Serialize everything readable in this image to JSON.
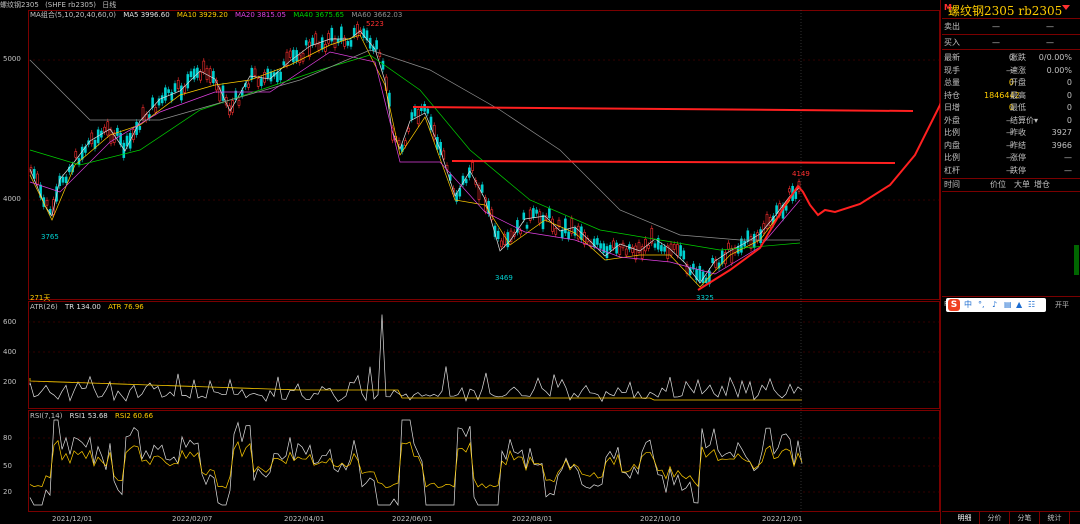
{
  "header": {
    "name": "螺纹钢2305",
    "exchange_code": "(SHFE rb2305)",
    "period": "日线"
  },
  "legend_ma": {
    "name": "MA组合(5,10,20,40,60,0)",
    "ma5": "MA5 3996.60",
    "ma10": "MA10 3929.20",
    "ma20": "MA20 3815.05",
    "ma40": "MA40 3675.65",
    "ma60": "MA60 3662.03"
  },
  "legend_atr": {
    "name": "ATR(26)",
    "tr": "TR 134.00",
    "atr": "ATR 76.96"
  },
  "legend_rsi": {
    "name": "RSI(7,14)",
    "rsi1": "RSI1 53.68",
    "rsi2": "RSI2 60.66"
  },
  "price_axis": [
    "5000",
    "4000"
  ],
  "atr_axis": [
    "600",
    "400",
    "200"
  ],
  "rsi_axis": [
    "80",
    "50",
    "20"
  ],
  "date_axis": [
    "2021/12/01",
    "2022/02/07",
    "2022/04/01",
    "2022/06/01",
    "2022/08/01",
    "2022/10/10",
    "2022/12/01"
  ],
  "annotations": {
    "high": "5223",
    "low1": "3765",
    "low2": "3469",
    "low3": "3325",
    "recent_high": "4149",
    "days": "271天"
  },
  "sidebar": {
    "title": "螺纹钢2305 rb2305",
    "marker": "M",
    "sell_label": "卖出",
    "sell_val": "—",
    "sell_qty": "—",
    "buy_label": "买入",
    "buy_val": "—",
    "buy_qty": "—",
    "rows": [
      {
        "k1": "最新",
        "v1": "0",
        "k2": "涨跌",
        "v2": "0/0.00%"
      },
      {
        "k1": "现手",
        "v1": "—",
        "k2": "速涨",
        "v2": "0.00%"
      },
      {
        "k1": "总量",
        "v1": "0",
        "k2": "开盘",
        "v2": "0"
      },
      {
        "k1": "持仓",
        "v1": "1846442",
        "k2": "最高",
        "v2": "0"
      },
      {
        "k1": "日增",
        "v1": "0",
        "k2": "最低",
        "v2": "0"
      },
      {
        "k1": "外盘",
        "v1": "—",
        "k2": "结算价▾",
        "v2": "0"
      },
      {
        "k1": "比例",
        "v1": "—",
        "k2": "昨收",
        "v2": "3927"
      },
      {
        "k1": "内盘",
        "v1": "—",
        "k2": "昨结",
        "v2": "3966"
      },
      {
        "k1": "比例",
        "v1": "—",
        "k2": "涨停",
        "v2": "—"
      },
      {
        "k1": "杠杆",
        "v1": "—",
        "k2": "跌停",
        "v2": "—"
      }
    ],
    "tick_header": {
      "time": "时间",
      "price": "价位",
      "volume": "大单",
      "change": "增仓",
      "open_type": "开平"
    },
    "ime": {
      "logo": "S",
      "lang": "中"
    },
    "tabs": [
      "明细",
      "分价",
      "分笔",
      "统计"
    ],
    "colors": {
      "up": "#ff3030",
      "down": "#00d0d0",
      "title": "#ffcc00"
    }
  }
}
